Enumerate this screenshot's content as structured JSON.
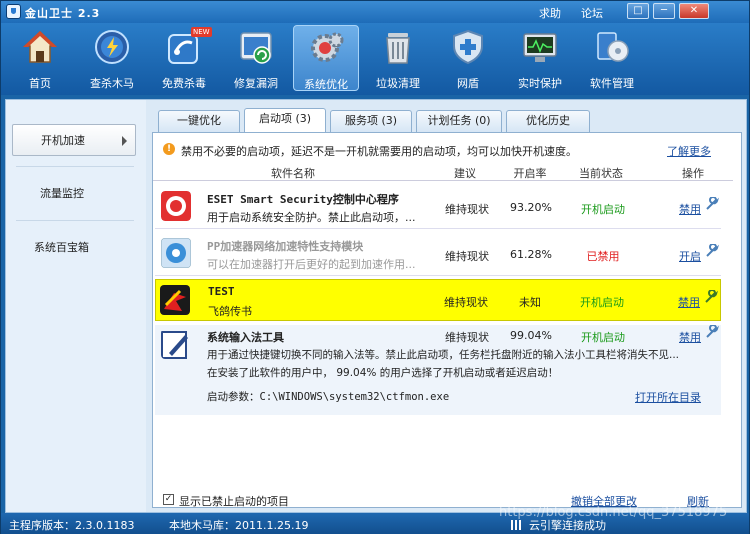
{
  "window": {
    "title": "金山卫士 2.3",
    "links": [
      "求助",
      "论坛"
    ],
    "controls": [
      "□",
      "─",
      "✕"
    ]
  },
  "toolbar": {
    "items": [
      {
        "label": "首页",
        "icon": "home-icon"
      },
      {
        "label": "查杀木马",
        "icon": "scan-trojan-icon"
      },
      {
        "label": "免费杀毒",
        "icon": "antivirus-icon",
        "badge": "NEW"
      },
      {
        "label": "修复漏洞",
        "icon": "patch-icon"
      },
      {
        "label": "系统优化",
        "icon": "optimize-gear-icon",
        "active": true
      },
      {
        "label": "垃圾清理",
        "icon": "trash-icon"
      },
      {
        "label": "网盾",
        "icon": "shield-icon"
      },
      {
        "label": "实时保护",
        "icon": "monitor-icon"
      },
      {
        "label": "软件管理",
        "icon": "software-disc-icon"
      }
    ]
  },
  "sidebar": {
    "items": [
      {
        "label": "开机加速",
        "active": true
      },
      {
        "label": "流量监控"
      },
      {
        "label": "系统百宝箱"
      }
    ]
  },
  "tabs": [
    "一键优化",
    "启动项 (3)",
    "服务项 (3)",
    "计划任务 (0)",
    "优化历史"
  ],
  "warning": {
    "text": "禁用不必要的启动项，延迟不是一开机就需要用的启动项，均可以加快开机速度。",
    "more": "了解更多"
  },
  "columns": [
    "软件名称",
    "建议",
    "开启率",
    "当前状态",
    "操作"
  ],
  "rows": [
    {
      "name": "ESET Smart Security控制中心程序",
      "desc": "用于启动系统安全防护。禁止此启动项，...",
      "advice": "维持现状",
      "rate": "93.20%",
      "status": "开机启动",
      "action": "禁用"
    },
    {
      "name": "PP加速器网络加速特性支持模块",
      "desc": "可以在加速器打开后更好的起到加速作用...",
      "advice": "维持现状",
      "rate": "61.28%",
      "status": "已禁用",
      "action": "开启"
    },
    {
      "name": "TEST",
      "desc": "飞鸽传书",
      "advice": "维持现状",
      "rate": "未知",
      "status": "开机启动",
      "action": "禁用"
    },
    {
      "name": "系统输入法工具",
      "desc": "用于通过快捷键切换不同的输入法等。禁止此启动项，任务栏托盘附近的输入法小工具栏将消失不见...",
      "desc2": "在安装了此软件的用户中， 99.04% 的用户选择了开机启动或者延迟启动！",
      "param": "启动参数：C:\\WINDOWS\\system32\\ctfmon.exe",
      "open_dir": "打开所在目录",
      "advice": "维持现状",
      "rate": "99.04%",
      "status": "开机启动",
      "action": "禁用"
    }
  ],
  "footer": {
    "checkbox_label": "显示已禁止启动的项目",
    "undo": "撤销全部更改",
    "refresh": "刷新"
  },
  "statusbar": {
    "version": "主程序版本：2.3.0.1183",
    "db": "本地木马库：2011.1.25.19",
    "engine": "云引擎连接成功",
    "watermark": "https://blog.csdn.net/qq_37518975"
  },
  "colors": {
    "accent": "#1a64a6",
    "highlight": "#ffff00",
    "enabled": "#1a9a1a",
    "disabled": "#e02020",
    "link": "#1b4fa0"
  }
}
